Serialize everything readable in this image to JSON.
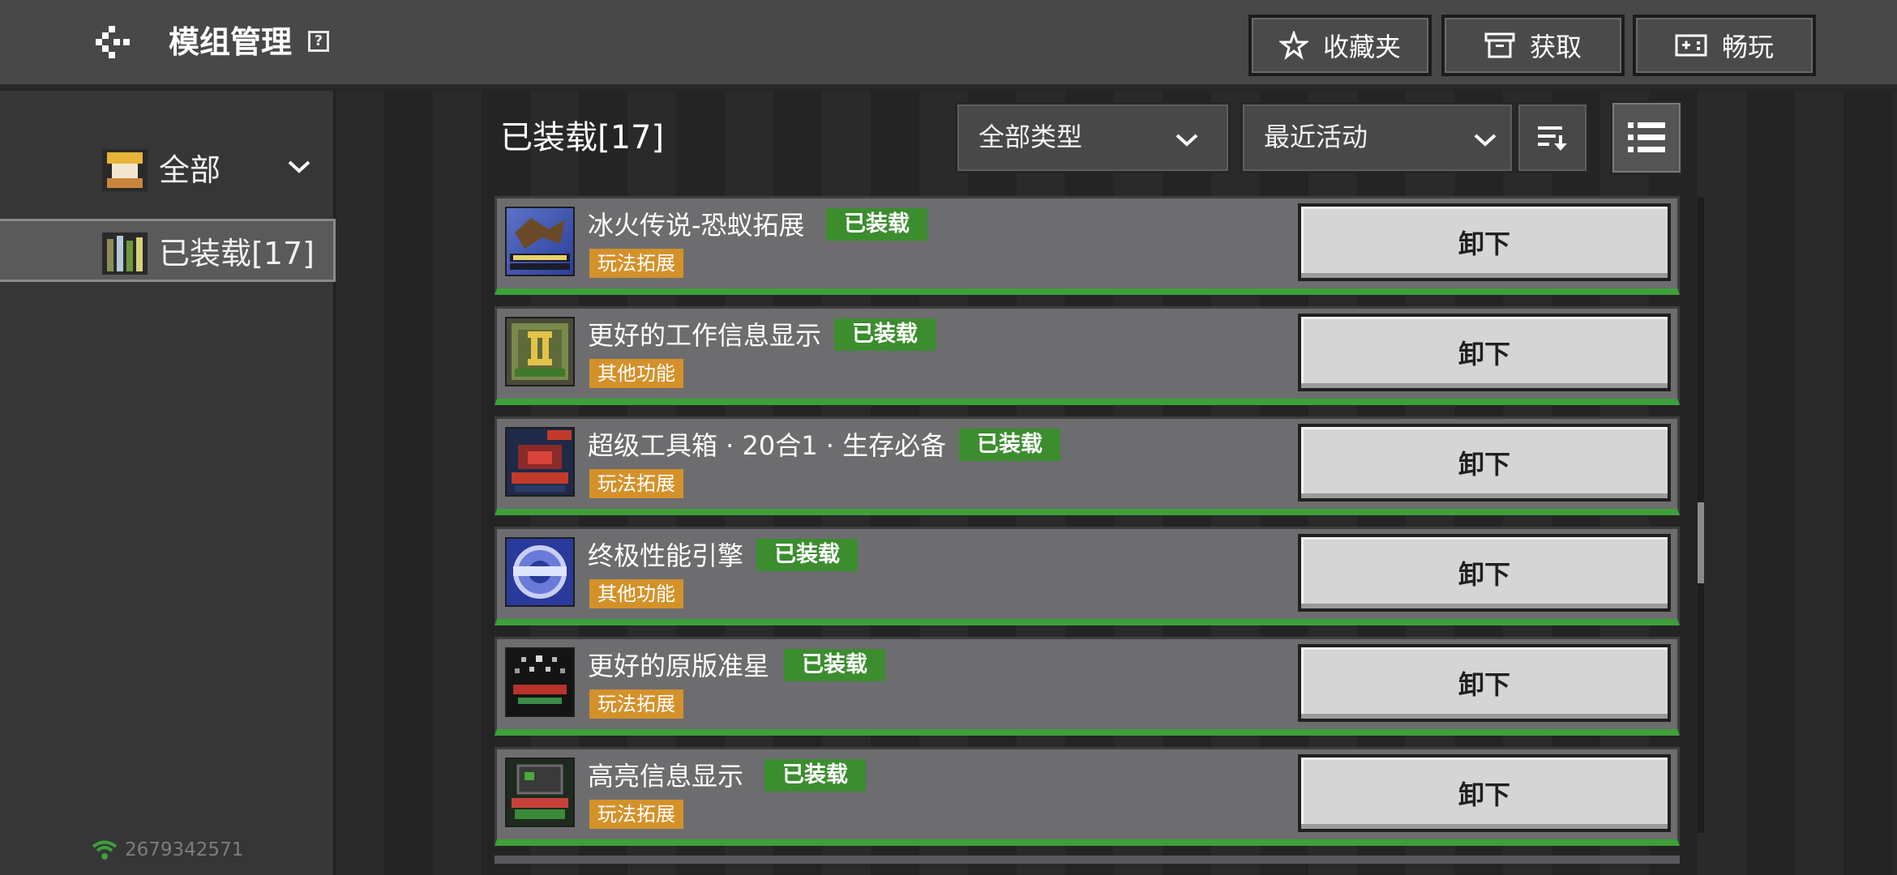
{
  "header": {
    "title": "模组管理",
    "help_icon": "?",
    "buttons": {
      "favorites": "收藏夹",
      "get": "获取",
      "play": "畅玩"
    }
  },
  "sidebar": {
    "items": [
      {
        "label": "全部",
        "icon": "all-mods-icon"
      },
      {
        "label": "已装载[17]",
        "icon": "installed-mods-icon",
        "selected": true
      }
    ],
    "network_id": "2679342571"
  },
  "main": {
    "section_title": "已装载[17]",
    "type_filter": "全部类型",
    "sort_by": "最近活动"
  },
  "mods": [
    {
      "name": "冰火传说-恐蚁拓展",
      "status": "已装载",
      "tag": "玩法拓展",
      "action": "卸下"
    },
    {
      "name": "更好的工作信息显示",
      "status": "已装载",
      "tag": "其他功能",
      "action": "卸下"
    },
    {
      "name": "超级工具箱 · 20合1 · 生存必备",
      "status": "已装载",
      "tag": "玩法拓展",
      "action": "卸下"
    },
    {
      "name": "终极性能引擎",
      "status": "已装载",
      "tag": "其他功能",
      "action": "卸下"
    },
    {
      "name": "更好的原版准星",
      "status": "已装载",
      "tag": "玩法拓展",
      "action": "卸下"
    },
    {
      "name": "高亮信息显示",
      "status": "已装载",
      "tag": "玩法拓展",
      "action": "卸下"
    }
  ],
  "colors": {
    "installed_badge": "#3b8d2e",
    "tag_badge": "#d4912a",
    "card_accent": "#3da03a"
  }
}
